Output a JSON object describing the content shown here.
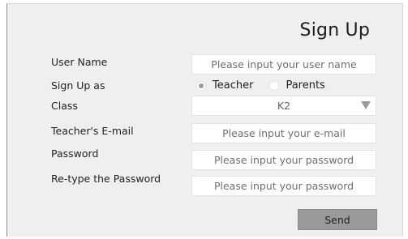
{
  "title": "Sign Up",
  "labels": {
    "user_name": "User Name",
    "sign_up_as": "Sign Up as",
    "class": "Class",
    "teacher_email": "Teacher's E-mail",
    "password": "Password",
    "retype_password": "Re-type the Password"
  },
  "fields": {
    "user_name_placeholder": "Please input your user name",
    "email_placeholder": "Please input your e-mail",
    "password_placeholder": "Please input your password",
    "retype_password_placeholder": "Please input your password"
  },
  "role": {
    "options": [
      {
        "label": "Teacher",
        "selected": true
      },
      {
        "label": "Parents",
        "selected": false
      }
    ]
  },
  "class_select": {
    "value": "K2"
  },
  "send_label": "Send",
  "icons": {
    "dropdown": "chevron-down-icon"
  }
}
